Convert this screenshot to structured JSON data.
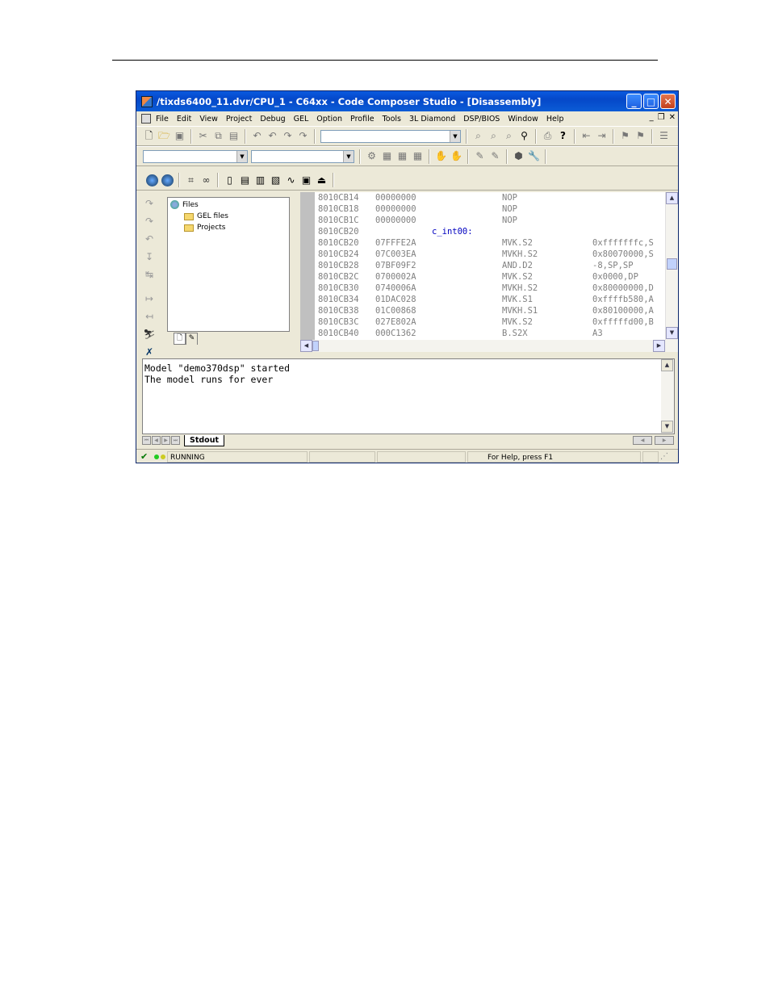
{
  "window": {
    "title": "/tixds6400_11.dvr/CPU_1 - C64xx - Code Composer Studio - [Disassembly]"
  },
  "menu": {
    "items": [
      "File",
      "Edit",
      "View",
      "Project",
      "Debug",
      "GEL",
      "Option",
      "Profile",
      "Tools",
      "3L Diamond",
      "DSP/BIOS",
      "Window",
      "Help"
    ]
  },
  "project_tree": {
    "root": "Files",
    "children": [
      "GEL files",
      "Projects"
    ]
  },
  "disassembly": {
    "rows": [
      {
        "addr": "8010CB14",
        "opcode": "00000000",
        "mnemonic": "NOP",
        "operands": ""
      },
      {
        "addr": "8010CB18",
        "opcode": "00000000",
        "mnemonic": "NOP",
        "operands": ""
      },
      {
        "addr": "8010CB1C",
        "opcode": "00000000",
        "mnemonic": "NOP",
        "operands": ""
      },
      {
        "addr": "8010CB20",
        "opcode": "",
        "mnemonic": "",
        "operands": ""
      },
      {
        "addr": "8010CB20",
        "opcode": "07FFFE2A",
        "mnemonic": "MVK.S2",
        "operands": "0xfffffffc,S"
      },
      {
        "addr": "8010CB24",
        "opcode": "07C003EA",
        "mnemonic": "MVKH.S2",
        "operands": "0x80070000,S"
      },
      {
        "addr": "8010CB28",
        "opcode": "07BF09F2",
        "mnemonic": "AND.D2",
        "operands": "-8,SP,SP"
      },
      {
        "addr": "8010CB2C",
        "opcode": "0700002A",
        "mnemonic": "MVK.S2",
        "operands": "0x0000,DP"
      },
      {
        "addr": "8010CB30",
        "opcode": "0740006A",
        "mnemonic": "MVKH.S2",
        "operands": "0x80000000,D"
      },
      {
        "addr": "8010CB34",
        "opcode": "01DAC028",
        "mnemonic": "MVK.S1",
        "operands": "0xffffb580,A"
      },
      {
        "addr": "8010CB38",
        "opcode": "01C00868",
        "mnemonic": "MVKH.S1",
        "operands": "0x80100000,A"
      },
      {
        "addr": "8010CB3C",
        "opcode": "027E802A",
        "mnemonic": "MVK.S2",
        "operands": "0xfffffd00,B"
      },
      {
        "addr": "8010CB40",
        "opcode": "000C1362",
        "mnemonic": "B.S2X",
        "operands": "A3"
      }
    ],
    "label": "c_int00:"
  },
  "output": {
    "lines": [
      "Model \"demo370dsp\" started",
      "The model runs for ever"
    ],
    "tab": "Stdout"
  },
  "status": {
    "state": "RUNNING",
    "help": "For Help, press F1"
  },
  "colors": {
    "title_bar": "#0a5ae0",
    "label": "#0000c0",
    "disasm_text": "#808080"
  }
}
